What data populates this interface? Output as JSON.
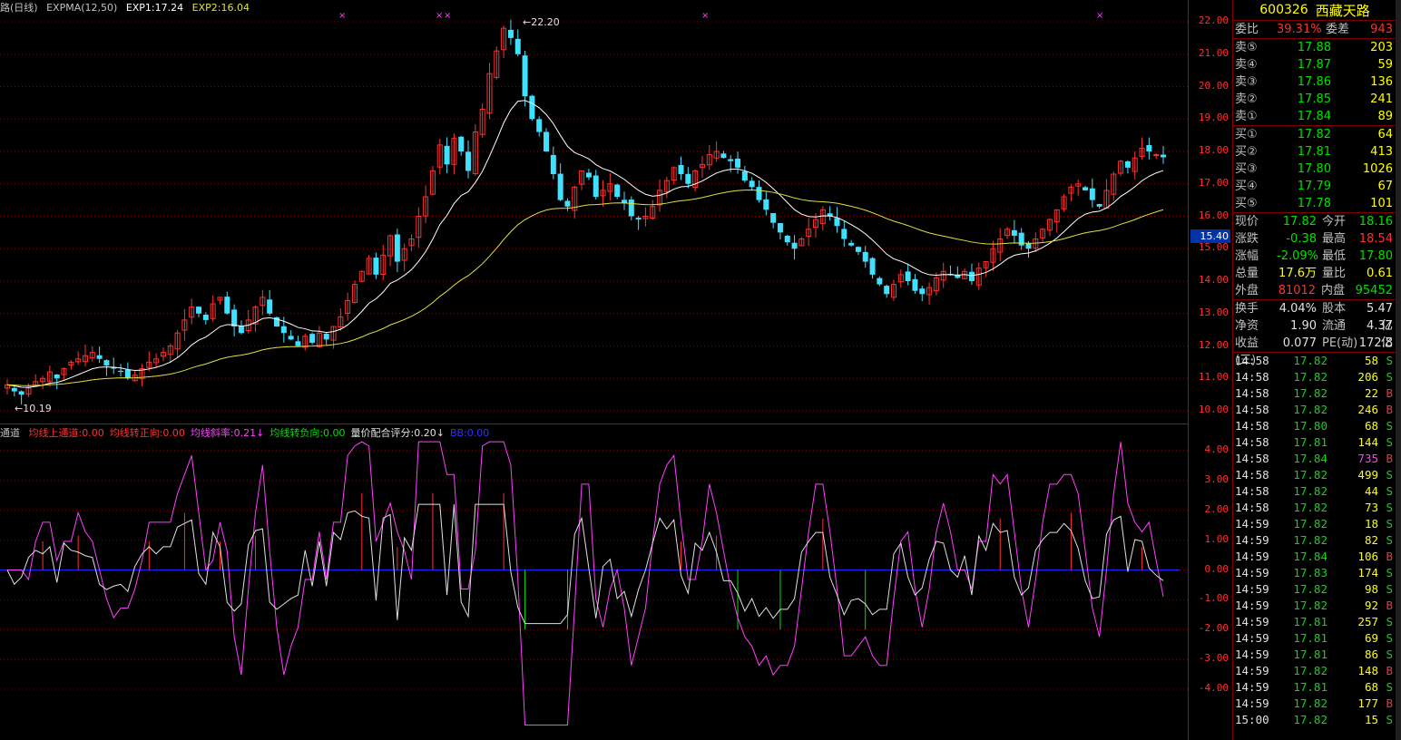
{
  "legend": {
    "name": "路(日线)",
    "indicator": "EXPMA(12,50)",
    "exp1": "EXP1:17.24",
    "exp2": "EXP2:16.04"
  },
  "indicator_legend": {
    "name": "通道",
    "items": [
      {
        "text": "均线上通道:0.00",
        "color": "#ff3030"
      },
      {
        "text": "均线转正向:0.00",
        "color": "#ff3030"
      },
      {
        "text": "均线斜率:0.21",
        "color": "#ff40ff",
        "arrow": "↓"
      },
      {
        "text": "均线转负向:0.00",
        "color": "#00e000"
      },
      {
        "text": "量价配合评分:0.20",
        "color": "#e0e0e0",
        "arrow": "↓"
      },
      {
        "text": "BB:0.00",
        "color": "#3030ff"
      }
    ]
  },
  "price_axis": {
    "ticks": [
      "22.00",
      "21.00",
      "20.00",
      "19.00",
      "18.00",
      "17.00",
      "16.00",
      "15.00",
      "14.00",
      "13.00",
      "12.00",
      "11.00",
      "10.00"
    ],
    "current": "15.40"
  },
  "indicator_axis": {
    "ticks": [
      "4.00",
      "3.00",
      "2.00",
      "1.00",
      "0.00",
      "-1.00",
      "-2.00",
      "-3.00",
      "-4.00"
    ]
  },
  "annotations": {
    "high": "22.20",
    "low": "10.19"
  },
  "colors": {
    "up": "#ff3030",
    "down": "#40e0ff",
    "exp1": "#ffffff",
    "exp2": "#e0e040",
    "grid": "#800000"
  },
  "chart_data": {
    "type": "candlestick",
    "price_range": [
      10,
      22.2
    ],
    "closes": [
      10.8,
      10.6,
      10.5,
      10.7,
      10.9,
      11.0,
      11.2,
      11.0,
      11.3,
      11.5,
      11.6,
      11.7,
      11.8,
      11.6,
      11.4,
      11.3,
      11.2,
      11.0,
      11.1,
      11.3,
      11.5,
      11.6,
      11.8,
      12.0,
      12.4,
      12.8,
      13.2,
      13.0,
      12.8,
      13.3,
      13.5,
      13.0,
      12.6,
      12.4,
      12.8,
      13.2,
      13.5,
      13.0,
      12.6,
      12.4,
      12.2,
      12.0,
      12.3,
      12.1,
      12.4,
      12.2,
      12.6,
      12.9,
      13.4,
      13.9,
      14.3,
      14.7,
      14.2,
      14.8,
      15.4,
      14.6,
      15.0,
      15.3,
      16.0,
      16.6,
      17.4,
      18.2,
      17.6,
      18.4,
      18.0,
      17.4,
      18.6,
      19.3,
      20.4,
      21.1,
      21.8,
      21.5,
      21.0,
      19.7,
      19.0,
      18.6,
      18.0,
      17.3,
      16.5,
      16.3,
      16.9,
      17.4,
      17.2,
      16.6,
      16.8,
      17.0,
      16.6,
      16.4,
      16.0,
      15.9,
      16.0,
      16.3,
      16.8,
      17.1,
      17.5,
      17.3,
      17.0,
      17.4,
      17.6,
      17.9,
      18.0,
      17.8,
      17.7,
      17.5,
      17.1,
      16.9,
      16.5,
      16.2,
      15.8,
      15.5,
      15.2,
      15.0,
      15.3,
      15.6,
      15.9,
      16.2,
      16.0,
      15.7,
      15.3,
      15.1,
      14.9,
      14.6,
      14.2,
      13.9,
      13.6,
      13.9,
      14.2,
      14.0,
      13.7,
      13.6,
      13.8,
      14.1,
      14.3,
      14.2,
      14.1,
      14.3,
      14.0,
      14.4,
      14.6,
      15.0,
      15.3,
      15.6,
      15.4,
      15.1,
      15.0,
      15.3,
      15.6,
      15.9,
      16.2,
      16.6,
      16.9,
      17.0,
      16.8,
      16.5,
      16.3,
      16.8,
      17.3,
      17.7,
      17.5,
      17.8,
      18.1,
      18.0,
      17.9,
      17.82
    ]
  },
  "quote": {
    "code": "600326",
    "name": "西藏天路",
    "weibi": {
      "label": "委比",
      "value": "39.31%",
      "label2": "委差",
      "value2": "943"
    },
    "sells": [
      {
        "label": "卖⑤",
        "price": "17.88",
        "vol": "203"
      },
      {
        "label": "卖④",
        "price": "17.87",
        "vol": "59"
      },
      {
        "label": "卖③",
        "price": "17.86",
        "vol": "136"
      },
      {
        "label": "卖②",
        "price": "17.85",
        "vol": "241"
      },
      {
        "label": "卖①",
        "price": "17.84",
        "vol": "89"
      }
    ],
    "buys": [
      {
        "label": "买①",
        "price": "17.82",
        "vol": "64"
      },
      {
        "label": "买②",
        "price": "17.81",
        "vol": "413"
      },
      {
        "label": "买③",
        "price": "17.80",
        "vol": "1026"
      },
      {
        "label": "买④",
        "price": "17.79",
        "vol": "67"
      },
      {
        "label": "买⑤",
        "price": "17.78",
        "vol": "101"
      }
    ],
    "stats1": [
      {
        "l": "现价",
        "v": "17.82",
        "c1": "green",
        "l2": "今开",
        "v2": "18.16",
        "c2": "green"
      },
      {
        "l": "涨跌",
        "v": "-0.38",
        "c1": "green",
        "l2": "最高",
        "v2": "18.54",
        "c2": "red"
      },
      {
        "l": "涨幅",
        "v": "-2.09%",
        "c1": "green",
        "l2": "最低",
        "v2": "17.80",
        "c2": "green"
      },
      {
        "l": "总量",
        "v": "17.6万",
        "c1": "yellow",
        "l2": "量比",
        "v2": "0.61",
        "c2": "yellow"
      },
      {
        "l": "外盘",
        "v": "81012",
        "c1": "red",
        "l2": "内盘",
        "v2": "95452",
        "c2": "green"
      }
    ],
    "stats2": [
      {
        "l": "换手",
        "v": "4.04%",
        "c1": "white",
        "l2": "股本",
        "v2": "5.47亿",
        "c2": "white"
      },
      {
        "l": "净资",
        "v": "1.90",
        "c1": "white",
        "l2": "流通",
        "v2": "4.37亿",
        "c2": "white"
      },
      {
        "l": "收益(三)",
        "v": "0.077",
        "c1": "white",
        "l2": "PE(动)",
        "v2": "172.8",
        "c2": "white"
      }
    ],
    "ticks": [
      {
        "t": "14:58",
        "p": "17.82",
        "v": "58",
        "d": "S"
      },
      {
        "t": "14:58",
        "p": "17.82",
        "v": "206",
        "d": "S"
      },
      {
        "t": "14:58",
        "p": "17.82",
        "v": "22",
        "d": "B"
      },
      {
        "t": "14:58",
        "p": "17.82",
        "v": "246",
        "d": "B"
      },
      {
        "t": "14:58",
        "p": "17.80",
        "v": "68",
        "d": "S"
      },
      {
        "t": "14:58",
        "p": "17.81",
        "v": "144",
        "d": "S"
      },
      {
        "t": "14:58",
        "p": "17.84",
        "v": "735",
        "d": "B"
      },
      {
        "t": "14:58",
        "p": "17.82",
        "v": "499",
        "d": "S"
      },
      {
        "t": "14:58",
        "p": "17.82",
        "v": "44",
        "d": "S"
      },
      {
        "t": "14:58",
        "p": "17.82",
        "v": "73",
        "d": "S"
      },
      {
        "t": "14:59",
        "p": "17.82",
        "v": "18",
        "d": "S"
      },
      {
        "t": "14:59",
        "p": "17.82",
        "v": "82",
        "d": "S"
      },
      {
        "t": "14:59",
        "p": "17.84",
        "v": "106",
        "d": "B"
      },
      {
        "t": "14:59",
        "p": "17.83",
        "v": "174",
        "d": "S"
      },
      {
        "t": "14:59",
        "p": "17.82",
        "v": "98",
        "d": "S"
      },
      {
        "t": "14:59",
        "p": "17.82",
        "v": "92",
        "d": "B"
      },
      {
        "t": "14:59",
        "p": "17.81",
        "v": "257",
        "d": "S"
      },
      {
        "t": "14:59",
        "p": "17.81",
        "v": "69",
        "d": "S"
      },
      {
        "t": "14:59",
        "p": "17.81",
        "v": "86",
        "d": "S"
      },
      {
        "t": "14:59",
        "p": "17.82",
        "v": "148",
        "d": "B"
      },
      {
        "t": "14:59",
        "p": "17.81",
        "v": "68",
        "d": "S"
      },
      {
        "t": "14:59",
        "p": "17.82",
        "v": "177",
        "d": "B"
      },
      {
        "t": "15:00",
        "p": "17.82",
        "v": "15",
        "d": "S"
      }
    ]
  }
}
